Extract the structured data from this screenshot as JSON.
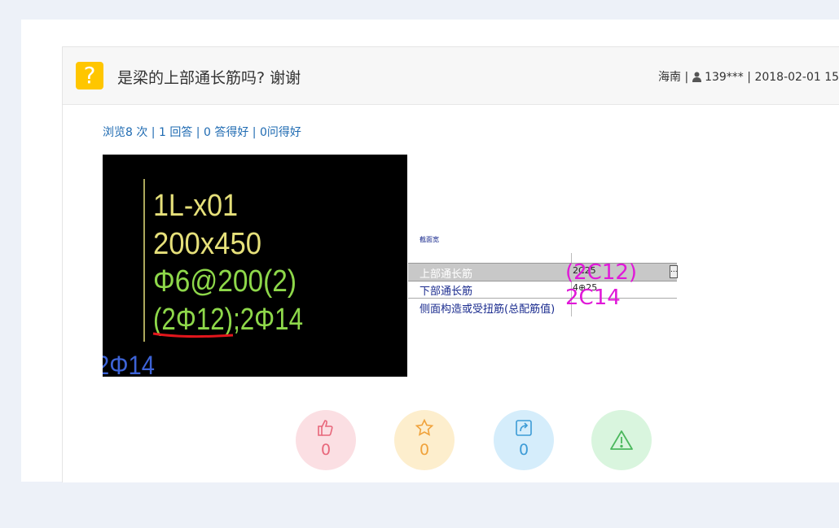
{
  "question": {
    "icon": "question-icon",
    "icon_glyph": "?",
    "title": "是梁的上部通长筋吗? 谢谢",
    "region": "海南",
    "user": "139***",
    "date": "2018-02-01 15",
    "meta_sep": " | "
  },
  "stats": {
    "views": "浏览8 次",
    "answers": "1 回答",
    "good_answers": "0 答得好",
    "good_questions": "0问得好",
    "sep": " | "
  },
  "cad_image": {
    "lines": [
      "1L-x01",
      "200x450",
      "Φ6@200(2)",
      "(2Φ12);2Φ14"
    ],
    "corner_text": "2Φ14",
    "colors": {
      "yellow": "#e6e07a",
      "green": "#8ed84a",
      "blue": "#3d63d6",
      "red": "#e2161c"
    }
  },
  "property_panel": {
    "row1_label": "截面宽",
    "row2_label": "上部通长筋",
    "row2_value": "2C25",
    "row3_label": "下部通长筋",
    "row3_value": "4⊕25",
    "row4_label": "侧面构造或受扭筋(总配筋值)",
    "ellipsis": "..."
  },
  "annotations": {
    "top": "(2C12)",
    "bottom": "2C14",
    "color": "#e018d8"
  },
  "actions": {
    "like": {
      "icon": "thumbs-up-icon",
      "count": "0"
    },
    "favorite": {
      "icon": "star-icon",
      "count": "0"
    },
    "share": {
      "icon": "share-icon",
      "count": "0"
    },
    "report": {
      "icon": "warning-icon"
    }
  }
}
